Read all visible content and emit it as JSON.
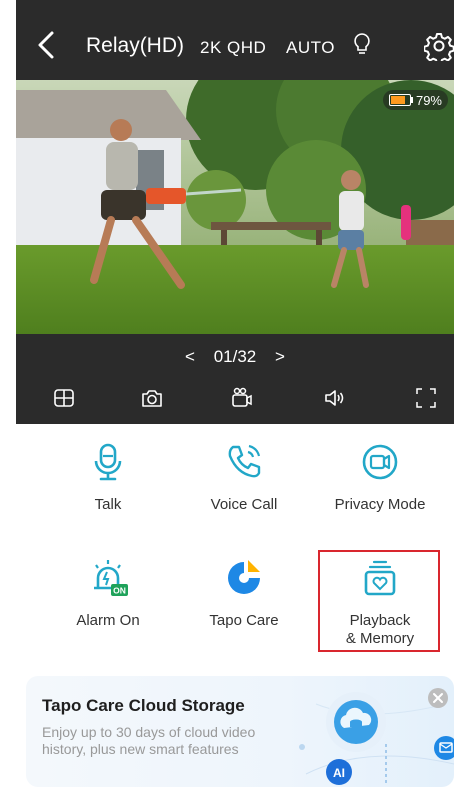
{
  "header": {
    "back_icon": "chevron-left-icon",
    "title": "Relay(HD)",
    "quality": "2K QHD",
    "mode": "AUTO",
    "bulb_icon": "lightbulb-icon",
    "settings_icon": "gear-icon"
  },
  "video": {
    "battery_percent": "79%",
    "battery_level": 0.79,
    "battery_color": "#ff9a1f"
  },
  "pager": {
    "prev": "<",
    "label": "01/32",
    "next": ">"
  },
  "controls": [
    {
      "icon": "grid-view-icon"
    },
    {
      "icon": "camera-icon"
    },
    {
      "icon": "video-record-icon"
    },
    {
      "icon": "speaker-icon"
    },
    {
      "icon": "fullscreen-icon"
    }
  ],
  "features": [
    {
      "label": "Talk",
      "icon": "microphone-icon"
    },
    {
      "label": "Voice Call",
      "icon": "phone-call-icon"
    },
    {
      "label": "Privacy Mode",
      "icon": "privacy-camera-icon"
    },
    {
      "label": "Alarm On",
      "icon": "alarm-icon",
      "badge": "ON"
    },
    {
      "label": "Tapo Care",
      "icon": "tapo-care-icon"
    },
    {
      "label": "Playback & Memory",
      "label_line1": "Playback",
      "label_line2": "& Memory",
      "icon": "playback-memory-icon"
    }
  ],
  "banner": {
    "title": "Tapo Care Cloud Storage",
    "description": "Enjoy up to 30 days of cloud video history, plus new smart features",
    "ai_label": "AI",
    "accent_color": "#1e88e5"
  },
  "colors": {
    "header_bg": "#2b2b2b",
    "icon_teal": "#22a7c8",
    "highlight_red": "#d9262e"
  }
}
